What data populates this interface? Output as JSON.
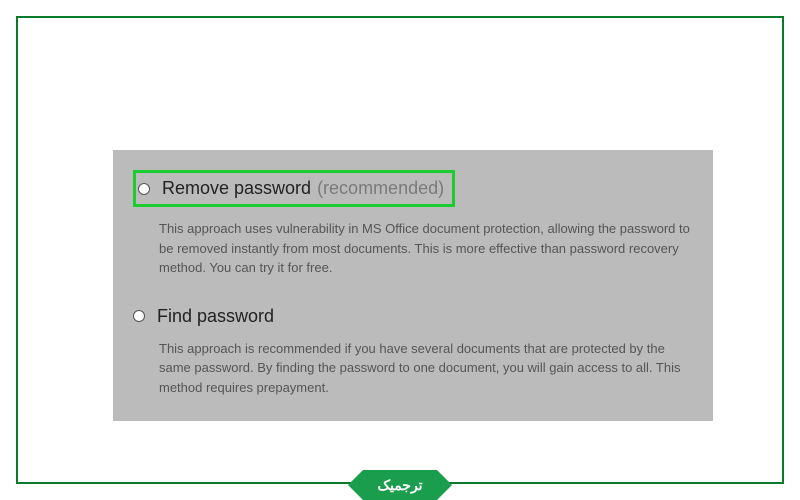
{
  "options": {
    "remove_password": {
      "title": "Remove password",
      "suffix": "(recommended)",
      "description": "This approach uses vulnerability in MS Office document protection, allowing the password to be removed instantly from most documents. This is more effective than password recovery method. You can try it for free."
    },
    "find_password": {
      "title": "Find password",
      "description": "This approach is recommended if you have several documents that are protected by the same password. By finding the password to one document, you will gain access to all. This method requires prepayment."
    }
  },
  "badge": {
    "label": "ترجمیک"
  }
}
